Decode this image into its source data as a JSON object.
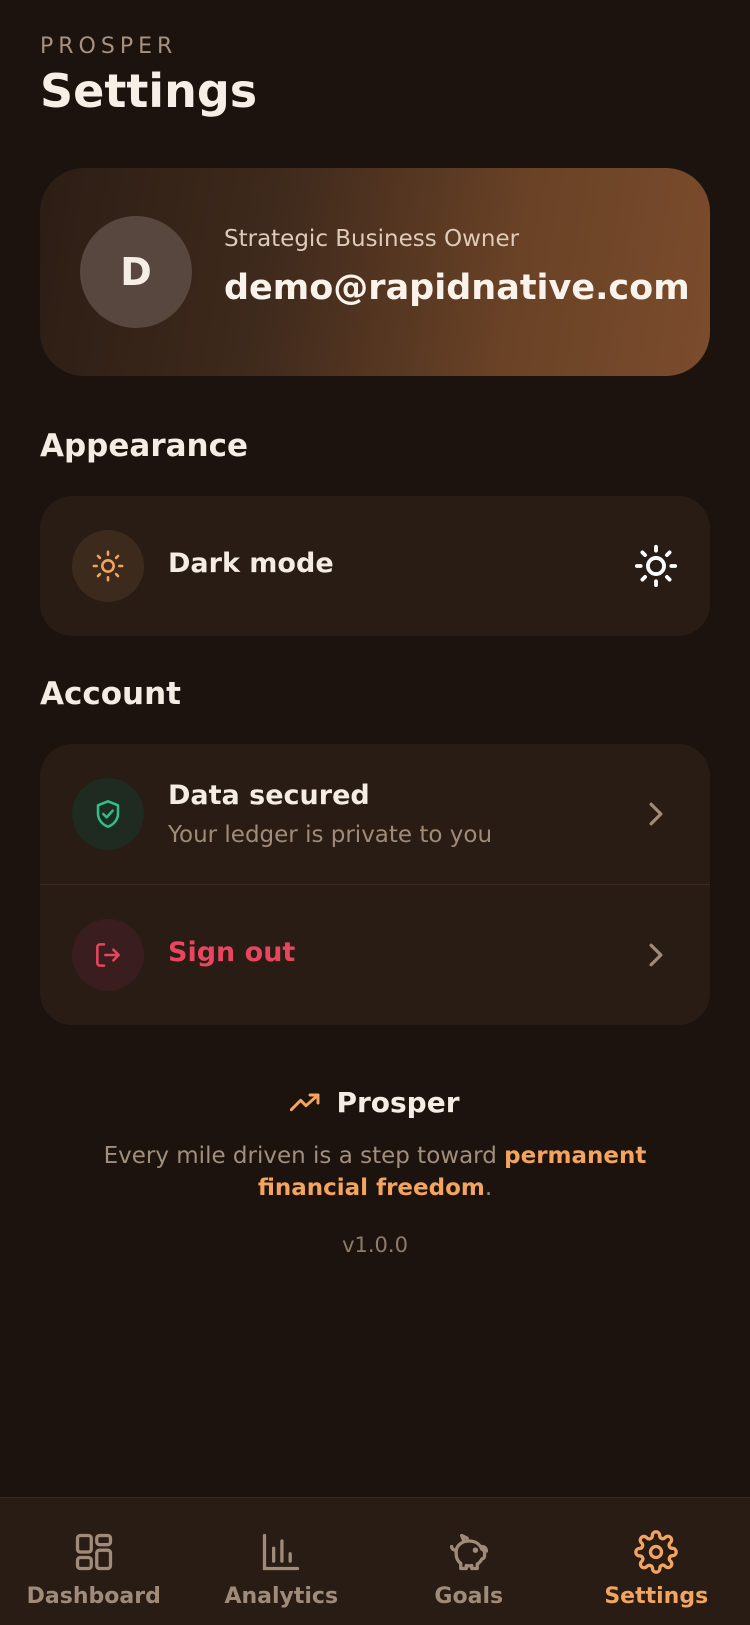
{
  "header": {
    "brand": "PROSPER",
    "title": "Settings"
  },
  "profile": {
    "avatar_initial": "D",
    "role": "Strategic Business Owner",
    "email": "demo@rapidnative.com"
  },
  "appearance": {
    "heading": "Appearance",
    "dark_mode_label": "Dark mode"
  },
  "account": {
    "heading": "Account",
    "data_secured_title": "Data secured",
    "data_secured_subtitle": "Your ledger is private to you",
    "sign_out_label": "Sign out"
  },
  "footer": {
    "brand": "Prosper",
    "tagline_prefix": "Every mile driven is a step toward ",
    "tagline_emphasis": "permanent financial freedom",
    "tagline_suffix": ".",
    "version": "v1.0.0"
  },
  "tabs": [
    {
      "label": "Dashboard",
      "icon": "grid-icon",
      "active": false
    },
    {
      "label": "Analytics",
      "icon": "bar-chart-icon",
      "active": false
    },
    {
      "label": "Goals",
      "icon": "piggy-bank-icon",
      "active": false
    },
    {
      "label": "Settings",
      "icon": "gear-icon",
      "active": true
    }
  ],
  "colors": {
    "background": "#1c130e",
    "card": "#281c15",
    "accent": "#f3a45e",
    "danger": "#e8465e",
    "success": "#2fc08a"
  }
}
